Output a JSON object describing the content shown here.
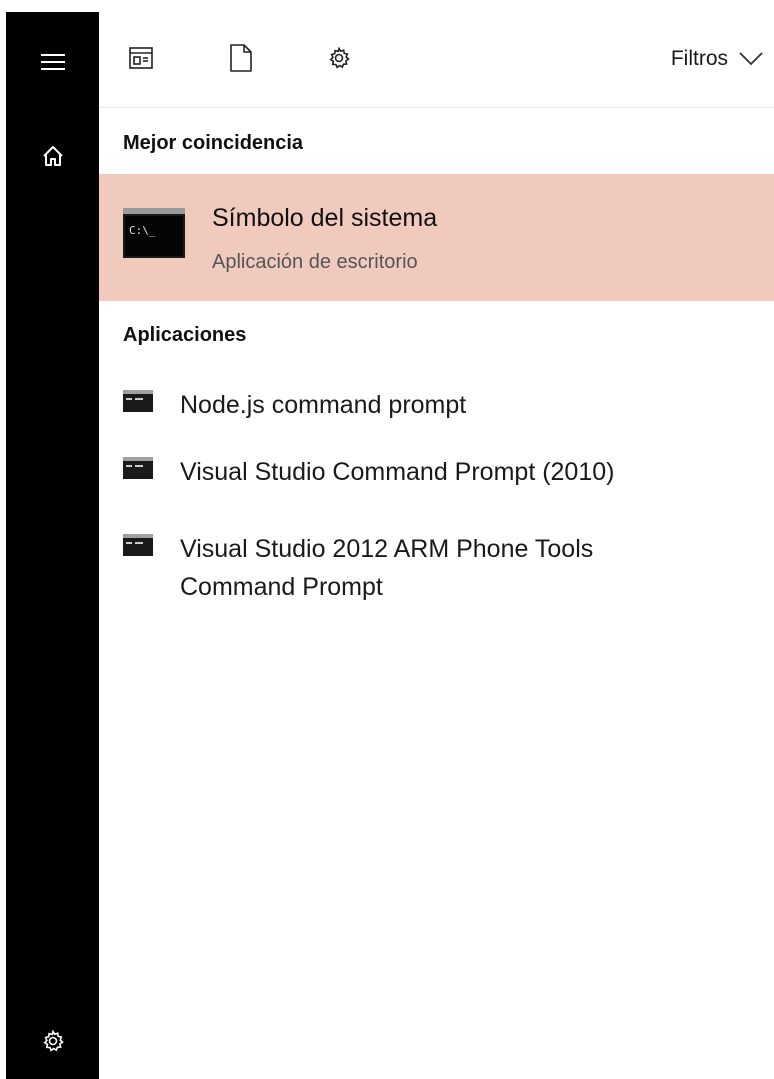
{
  "sidebar": {
    "items": [
      {
        "icon": "hamburger-menu-icon"
      },
      {
        "icon": "home-icon"
      },
      {
        "icon": "gear-icon"
      }
    ]
  },
  "toolbar": {
    "icons": [
      "apps-filter-icon",
      "documents-filter-icon",
      "settings-filter-icon"
    ],
    "filters_label": "Filtros"
  },
  "best_match": {
    "heading": "Mejor coincidencia",
    "title": "Símbolo del sistema",
    "subtitle": "Aplicación de escritorio",
    "icon": "command-prompt-icon",
    "icon_text": "C:\\_",
    "highlight_color": "#f0cbbd"
  },
  "apps": {
    "heading": "Aplicaciones",
    "items": [
      {
        "label": "Node.js command prompt",
        "icon": "command-prompt-icon"
      },
      {
        "label": "Visual Studio Command Prompt (2010)",
        "icon": "command-prompt-icon"
      },
      {
        "label": "Visual Studio 2012 ARM Phone Tools Command Prompt",
        "icon": "command-prompt-icon"
      }
    ]
  }
}
